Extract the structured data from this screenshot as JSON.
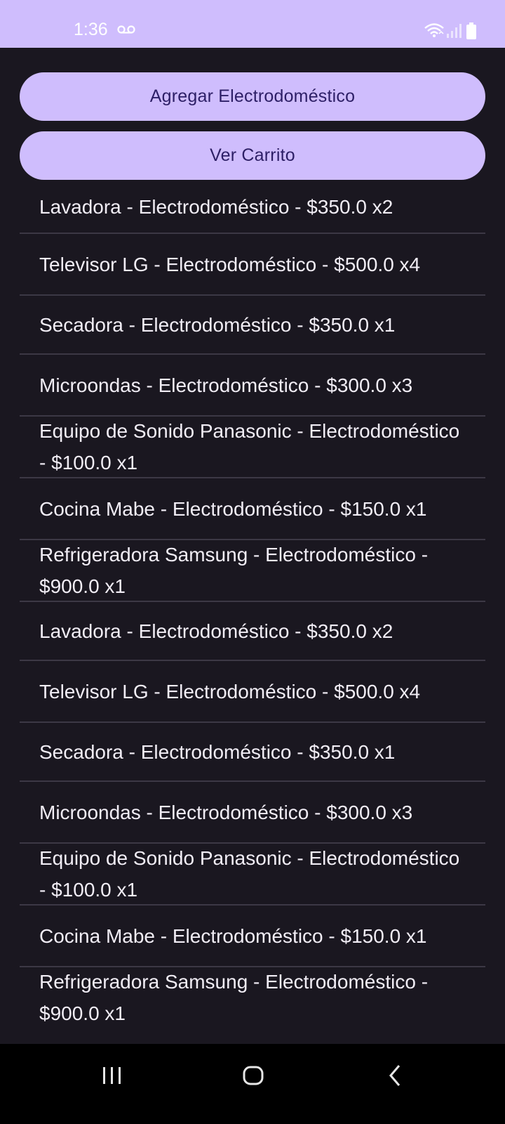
{
  "status_bar": {
    "time": "1:36",
    "icons": [
      "voicemail-icon",
      "wifi-icon",
      "signal-icon",
      "battery-icon"
    ]
  },
  "buttons": {
    "add_appliance": "Agregar Electrodoméstico",
    "view_cart": "Ver Carrito"
  },
  "items": [
    {
      "text": "Lavadora - Electrodoméstico - $350.0 x2"
    },
    {
      "text": "Televisor LG - Electrodoméstico - $500.0 x4"
    },
    {
      "text": "Secadora - Electrodoméstico - $350.0 x1"
    },
    {
      "text": "Microondas - Electrodoméstico - $300.0 x3"
    },
    {
      "text": "Equipo de Sonido Panasonic - Electrodoméstico - $100.0 x1"
    },
    {
      "text": "Cocina Mabe - Electrodoméstico - $150.0 x1"
    },
    {
      "text": "Refrigeradora Samsung - Electrodoméstico - $900.0 x1"
    },
    {
      "text": "Lavadora - Electrodoméstico - $350.0 x2"
    },
    {
      "text": "Televisor LG - Electrodoméstico - $500.0 x4"
    },
    {
      "text": "Secadora - Electrodoméstico - $350.0 x1"
    },
    {
      "text": "Microondas - Electrodoméstico - $300.0 x3"
    },
    {
      "text": "Equipo de Sonido Panasonic - Electrodoméstico - $100.0 x1"
    },
    {
      "text": "Cocina Mabe - Electrodoméstico - $150.0 x1"
    },
    {
      "text": "Refrigeradora Samsung - Electrodoméstico - $900.0 x1"
    }
  ],
  "nav_bar": {
    "icons": [
      "recents-icon",
      "home-icon",
      "back-icon"
    ]
  },
  "colors": {
    "accent": "#cfbdfd",
    "background": "#1a1720",
    "button_text": "#2d1f66",
    "item_text": "#f1edf5",
    "divider": "#3c3845"
  }
}
